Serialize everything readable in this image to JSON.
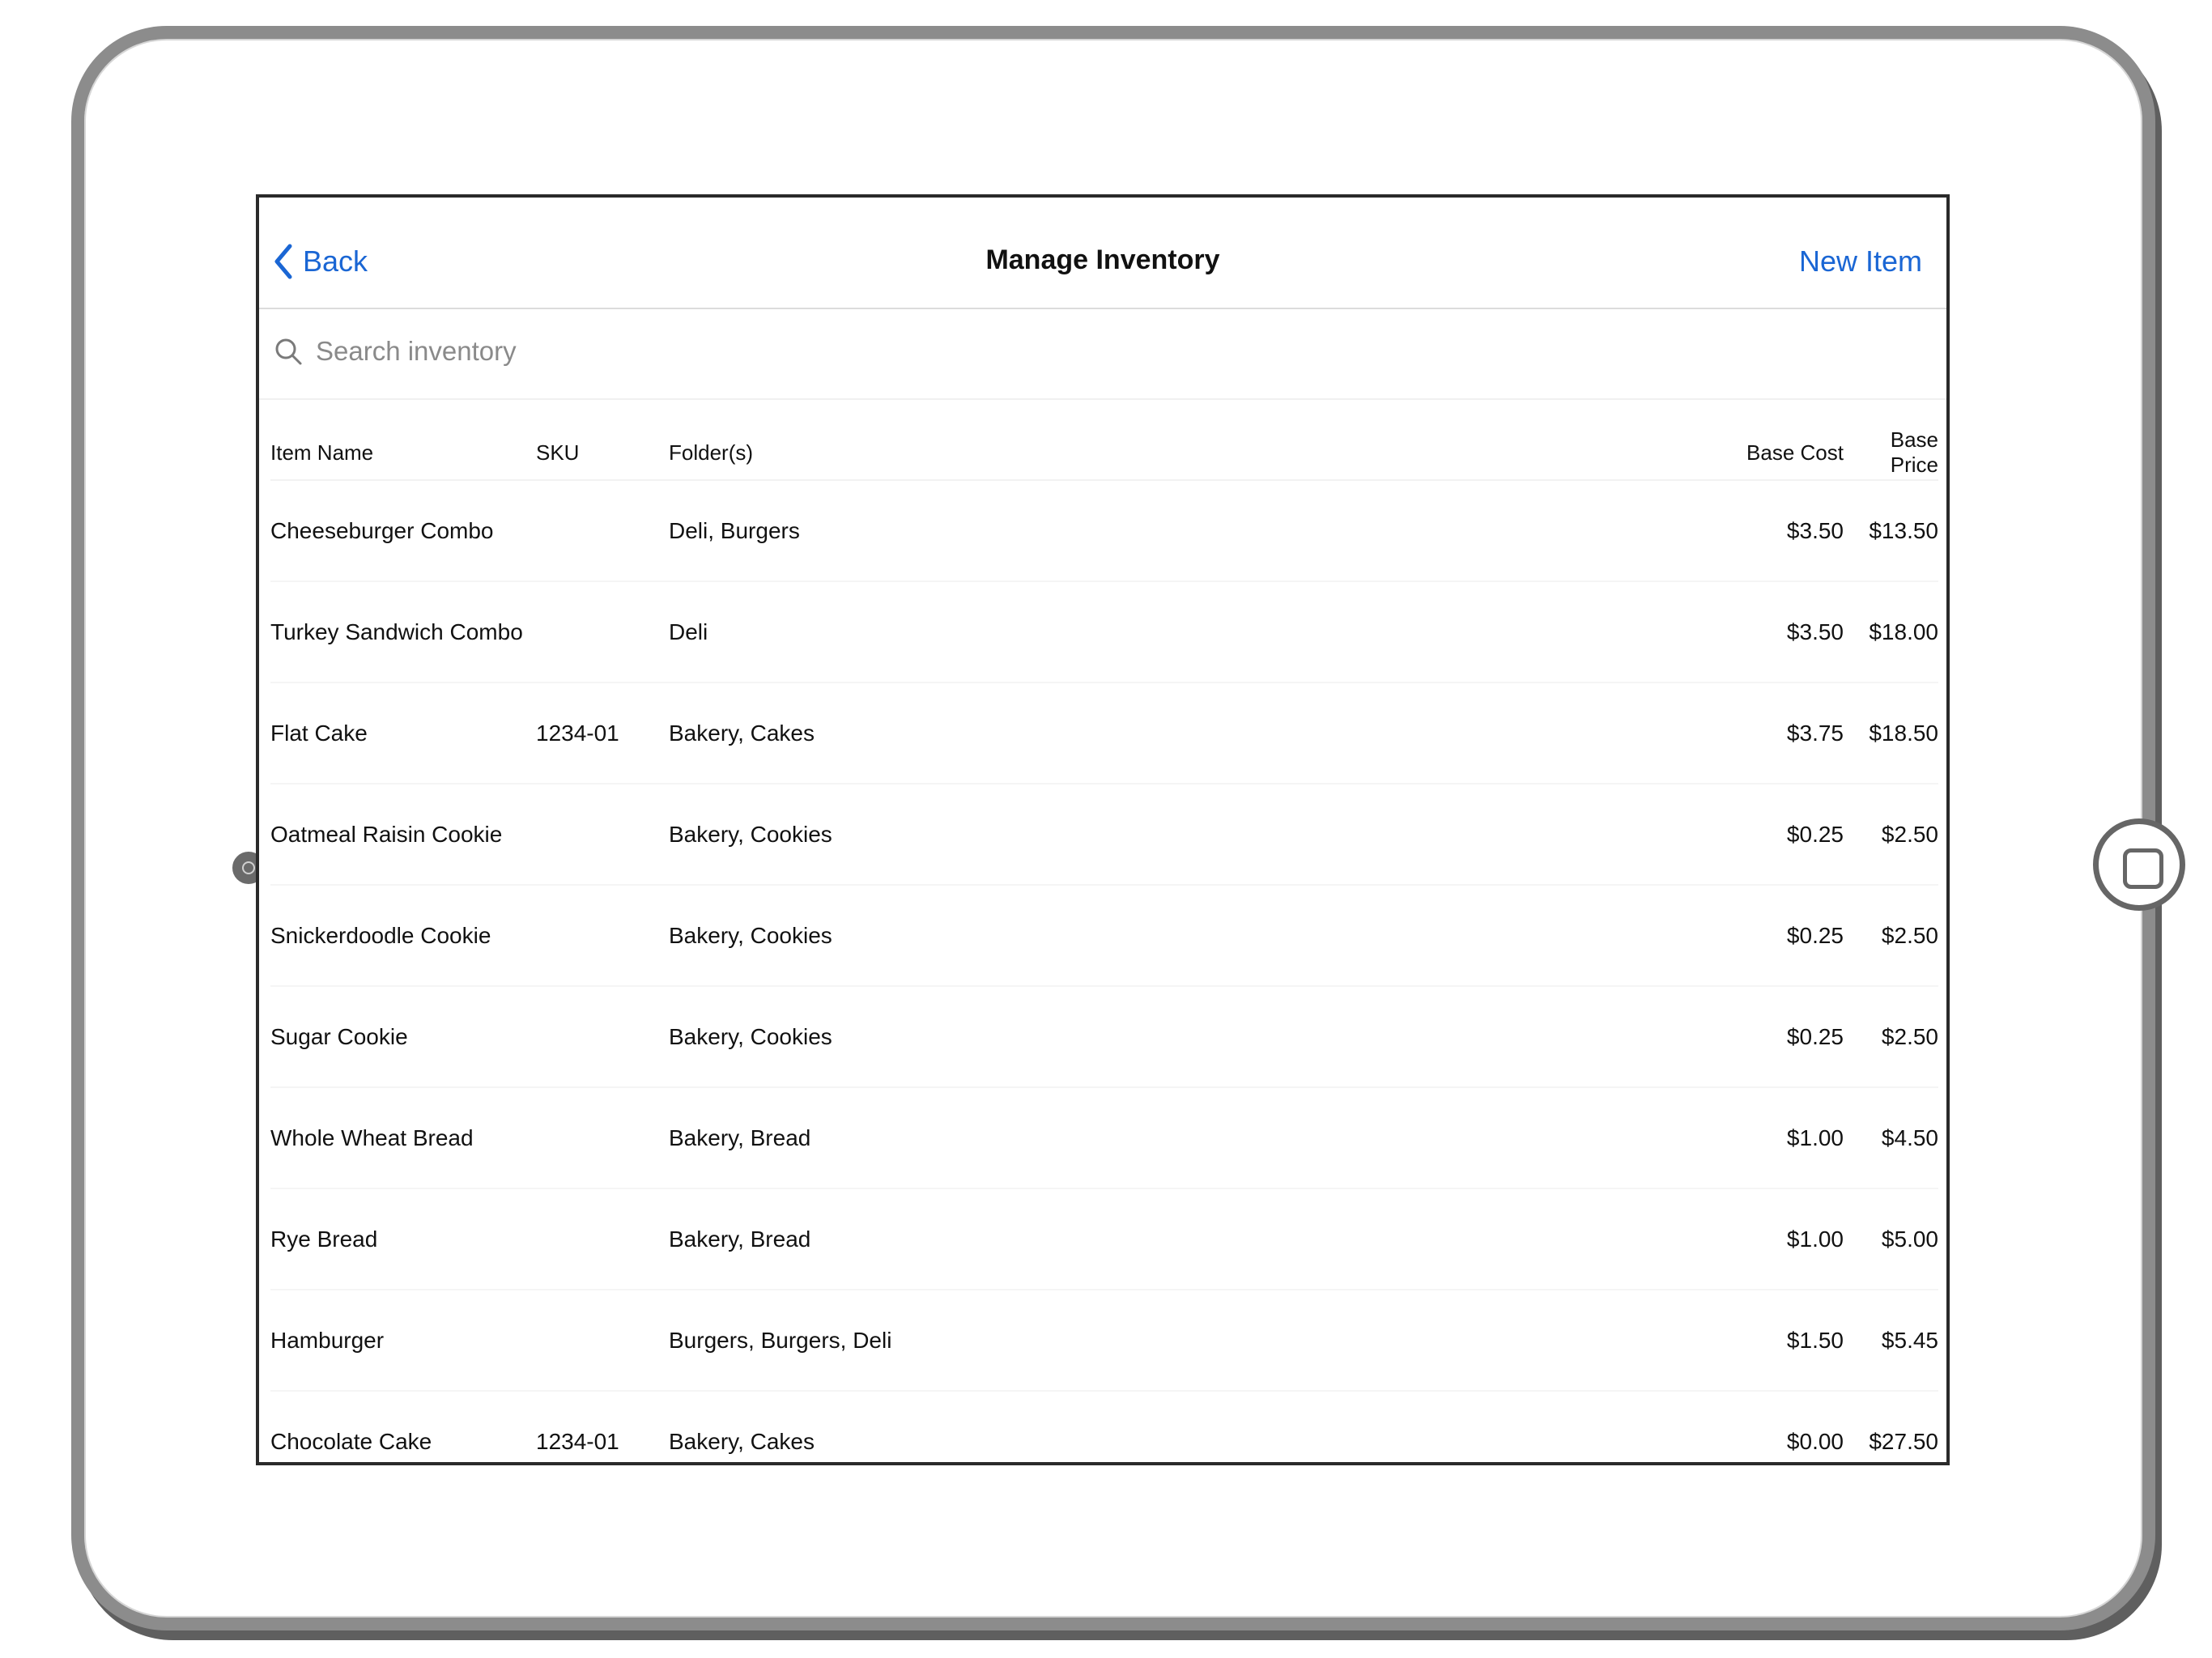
{
  "nav": {
    "back_label": "Back",
    "title": "Manage Inventory",
    "new_item_label": "New Item"
  },
  "search": {
    "placeholder": "Search inventory",
    "value": ""
  },
  "table": {
    "headers": {
      "name": "Item Name",
      "sku": "SKU",
      "folders": "Folder(s)",
      "cost": "Base Cost",
      "price": "Base Price"
    },
    "rows": [
      {
        "name": "Cheeseburger Combo",
        "sku": "",
        "folders": "Deli, Burgers",
        "cost": "$3.50",
        "price": "$13.50"
      },
      {
        "name": "Turkey Sandwich Combo",
        "sku": "",
        "folders": "Deli",
        "cost": "$3.50",
        "price": "$18.00"
      },
      {
        "name": "Flat Cake",
        "sku": "1234-01",
        "folders": "Bakery, Cakes",
        "cost": "$3.75",
        "price": "$18.50"
      },
      {
        "name": "Oatmeal Raisin Cookie",
        "sku": "",
        "folders": "Bakery, Cookies",
        "cost": "$0.25",
        "price": "$2.50"
      },
      {
        "name": "Snickerdoodle Cookie",
        "sku": "",
        "folders": "Bakery, Cookies",
        "cost": "$0.25",
        "price": "$2.50"
      },
      {
        "name": "Sugar Cookie",
        "sku": "",
        "folders": "Bakery, Cookies",
        "cost": "$0.25",
        "price": "$2.50"
      },
      {
        "name": "Whole Wheat Bread",
        "sku": "",
        "folders": "Bakery, Bread",
        "cost": "$1.00",
        "price": "$4.50"
      },
      {
        "name": "Rye Bread",
        "sku": "",
        "folders": "Bakery, Bread",
        "cost": "$1.00",
        "price": "$5.00"
      },
      {
        "name": "Hamburger",
        "sku": "",
        "folders": "Burgers, Burgers, Deli",
        "cost": "$1.50",
        "price": "$5.45"
      },
      {
        "name": "Chocolate Cake",
        "sku": "1234-01",
        "folders": "Bakery, Cakes",
        "cost": "$0.00",
        "price": "$27.50"
      }
    ]
  },
  "icons": {
    "back": "chevron-left-icon",
    "search": "search-icon",
    "camera": "camera-icon",
    "home": "home-button-icon"
  },
  "colors": {
    "accent": "#1a66d4",
    "text": "#111111",
    "placeholder": "#8a8a8a",
    "device_frame": "#8c8c8c"
  }
}
